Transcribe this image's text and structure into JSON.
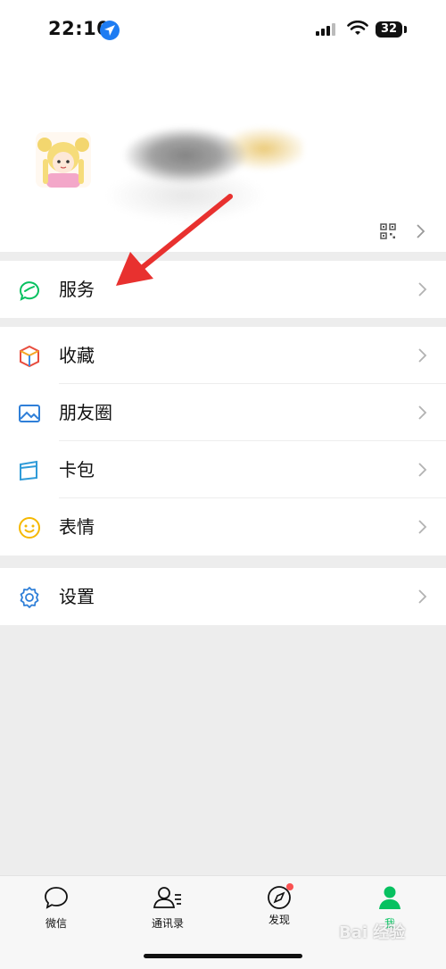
{
  "status": {
    "time": "22:10",
    "battery": "32"
  },
  "menu": {
    "services": "服务",
    "favorites": "收藏",
    "moments": "朋友圈",
    "cards": "卡包",
    "stickers": "表情",
    "settings": "设置"
  },
  "tabs": [
    {
      "label": "微信",
      "icon": "chat-icon"
    },
    {
      "label": "通讯录",
      "icon": "contacts-icon"
    },
    {
      "label": "发现",
      "icon": "compass-icon"
    },
    {
      "label": "我",
      "icon": "person-icon"
    }
  ],
  "watermark": "Bai 经验",
  "colors": {
    "accent": "#07c160",
    "badge": "#fa5151",
    "annotation_arrow": "#e8312f"
  }
}
